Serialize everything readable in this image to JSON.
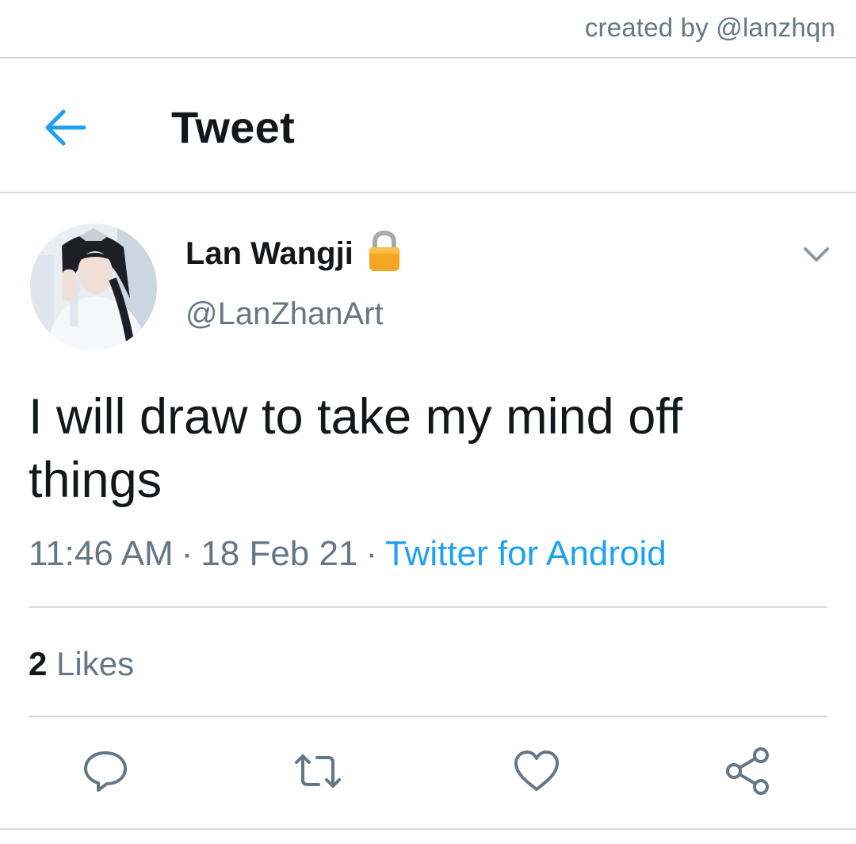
{
  "watermark": "created by @lanzhqn",
  "header": {
    "back_icon": "arrow-left-icon",
    "title": "Tweet"
  },
  "tweet": {
    "author": {
      "display_name": "Lan Wangji",
      "protected_icon": "lock-icon",
      "handle": "@LanZhanArt",
      "avatar": "avatar-photo"
    },
    "menu_icon": "chevron-down-icon",
    "text": "I will draw to take my mind off things",
    "time": "11:46 AM",
    "date": "18 Feb 21",
    "separator": "·",
    "source": "Twitter for Android",
    "likes": {
      "count": "2",
      "label": "Likes"
    },
    "actions": [
      {
        "name": "reply",
        "icon": "comment-icon"
      },
      {
        "name": "retweet",
        "icon": "retweet-icon"
      },
      {
        "name": "like",
        "icon": "heart-icon"
      },
      {
        "name": "share",
        "icon": "share-icon"
      }
    ]
  },
  "colors": {
    "accent": "#1da1f2",
    "text_primary": "#14171a",
    "text_secondary": "#657786",
    "divider": "#d5dbe0",
    "lock_body": "#f5a623"
  }
}
